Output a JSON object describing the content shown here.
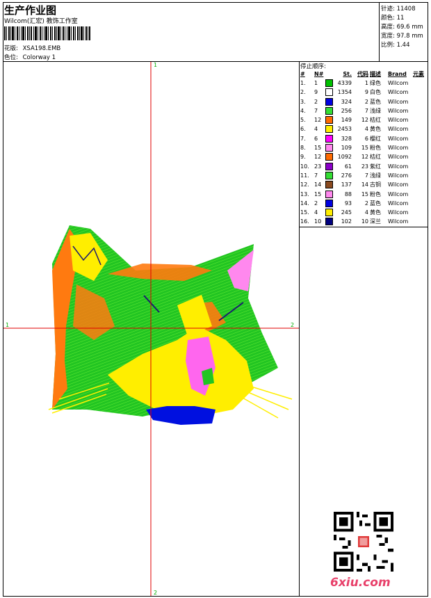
{
  "header": {
    "title": "生产作业图",
    "subtitle": "Wilcom(汇宏) 教饰工作室",
    "pattern_label": "花版:",
    "pattern_value": "XSA198.EMB",
    "colorway_label": "色位:",
    "colorway_value": "Colorway 1"
  },
  "stats": {
    "stitches": "针迹: 11408",
    "colors": "颜色: 11",
    "height": "高度: 69.6 mm",
    "width": "宽度: 97.8 mm",
    "scale": "比例: 1.44"
  },
  "stop_sequence": {
    "title": "停止顺序:",
    "headers": [
      "#",
      "N#",
      "St.",
      "代码",
      "描述",
      "Brand",
      "元素"
    ],
    "rows": [
      {
        "idx": "1.",
        "n": "1",
        "color": "#00c000",
        "st": "4339",
        "code": "1",
        "desc": "绿色",
        "brand": "Wilcom"
      },
      {
        "idx": "2.",
        "n": "9",
        "color": "#ffffff",
        "st": "1354",
        "code": "9",
        "desc": "白色",
        "brand": "Wilcom"
      },
      {
        "idx": "3.",
        "n": "2",
        "color": "#0000e0",
        "st": "324",
        "code": "2",
        "desc": "蓝色",
        "brand": "Wilcom"
      },
      {
        "idx": "4.",
        "n": "7",
        "color": "#33dd33",
        "st": "256",
        "code": "7",
        "desc": "浅绿",
        "brand": "Wilcom"
      },
      {
        "idx": "5.",
        "n": "12",
        "color": "#ff6a00",
        "st": "149",
        "code": "12",
        "desc": "桔红",
        "brand": "Wilcom"
      },
      {
        "idx": "6.",
        "n": "4",
        "color": "#ffee00",
        "st": "2453",
        "code": "4",
        "desc": "黄色",
        "brand": "Wilcom"
      },
      {
        "idx": "7.",
        "n": "6",
        "color": "#ff00ff",
        "st": "328",
        "code": "6",
        "desc": "樱红",
        "brand": "Wilcom"
      },
      {
        "idx": "8.",
        "n": "15",
        "color": "#ff88ee",
        "st": "109",
        "code": "15",
        "desc": "粉色",
        "brand": "Wilcom"
      },
      {
        "idx": "9.",
        "n": "12",
        "color": "#ff6a00",
        "st": "1092",
        "code": "12",
        "desc": "桔红",
        "brand": "Wilcom"
      },
      {
        "idx": "10.",
        "n": "23",
        "color": "#8a00c8",
        "st": "61",
        "code": "23",
        "desc": "紫红",
        "brand": "Wilcom"
      },
      {
        "idx": "11.",
        "n": "7",
        "color": "#33dd33",
        "st": "276",
        "code": "7",
        "desc": "浅绿",
        "brand": "Wilcom"
      },
      {
        "idx": "12.",
        "n": "14",
        "color": "#8a4a20",
        "st": "137",
        "code": "14",
        "desc": "古铜",
        "brand": "Wilcom"
      },
      {
        "idx": "13.",
        "n": "15",
        "color": "#ff88ee",
        "st": "88",
        "code": "15",
        "desc": "粉色",
        "brand": "Wilcom"
      },
      {
        "idx": "14.",
        "n": "2",
        "color": "#0000e0",
        "st": "93",
        "code": "2",
        "desc": "蓝色",
        "brand": "Wilcom"
      },
      {
        "idx": "15.",
        "n": "4",
        "color": "#ffee00",
        "st": "245",
        "code": "4",
        "desc": "黄色",
        "brand": "Wilcom"
      },
      {
        "idx": "16.",
        "n": "10",
        "color": "#000080",
        "st": "102",
        "code": "10",
        "desc": "深兰",
        "brand": "Wilcom"
      }
    ]
  },
  "axis_labels": {
    "top": "1",
    "bottom": "2",
    "left": "1",
    "right": "2"
  },
  "watermark": "6xiu.com"
}
